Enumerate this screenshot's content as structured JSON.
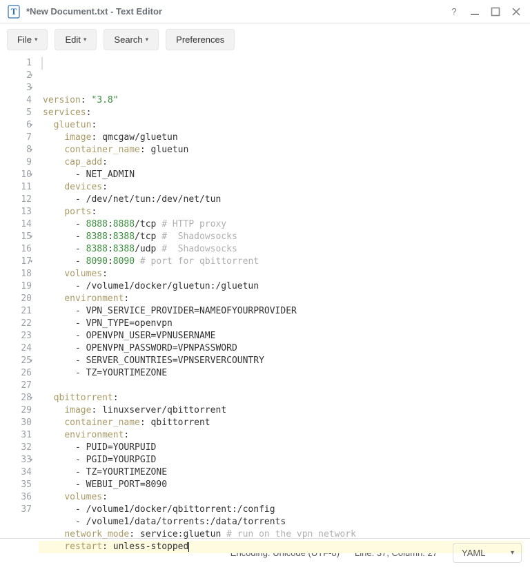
{
  "window": {
    "title": "*New Document.txt - Text Editor"
  },
  "menu": {
    "file": "File",
    "edit": "Edit",
    "search": "Search",
    "preferences": "Preferences"
  },
  "gutter": {
    "foldable": [
      2,
      3,
      6,
      8,
      10,
      15,
      17,
      25,
      28,
      33
    ]
  },
  "lines": {
    "1": {
      "i": "",
      "s": [
        [
          "key",
          "version"
        ],
        [
          "def",
          ": "
        ],
        [
          "str",
          "\"3.8\""
        ]
      ]
    },
    "2": {
      "i": "",
      "s": [
        [
          "key",
          "services"
        ],
        [
          "def",
          ":"
        ]
      ]
    },
    "3": {
      "i": "  ",
      "s": [
        [
          "key",
          "gluetun"
        ],
        [
          "def",
          ":"
        ]
      ]
    },
    "4": {
      "i": "    ",
      "s": [
        [
          "key",
          "image"
        ],
        [
          "def",
          ": qmcgaw/gluetun"
        ]
      ]
    },
    "5": {
      "i": "    ",
      "s": [
        [
          "key",
          "container_name"
        ],
        [
          "def",
          ": gluetun"
        ]
      ]
    },
    "6": {
      "i": "    ",
      "s": [
        [
          "key",
          "cap_add"
        ],
        [
          "def",
          ":"
        ]
      ]
    },
    "7": {
      "i": "      ",
      "s": [
        [
          "def",
          "- NET_ADMIN"
        ]
      ]
    },
    "8": {
      "i": "    ",
      "s": [
        [
          "key",
          "devices"
        ],
        [
          "def",
          ":"
        ]
      ]
    },
    "9": {
      "i": "      ",
      "s": [
        [
          "def",
          "- /dev/net/tun:/dev/net/tun"
        ]
      ]
    },
    "10": {
      "i": "    ",
      "s": [
        [
          "key",
          "ports"
        ],
        [
          "def",
          ":"
        ]
      ]
    },
    "11": {
      "i": "      ",
      "s": [
        [
          "def",
          "- "
        ],
        [
          "num",
          "8888"
        ],
        [
          "def",
          ":"
        ],
        [
          "num",
          "8888"
        ],
        [
          "def",
          "/tcp "
        ],
        [
          "cmt",
          "# HTTP proxy"
        ]
      ]
    },
    "12": {
      "i": "      ",
      "s": [
        [
          "def",
          "- "
        ],
        [
          "num",
          "8388"
        ],
        [
          "def",
          ":"
        ],
        [
          "num",
          "8388"
        ],
        [
          "def",
          "/tcp "
        ],
        [
          "cmt",
          "#  Shadowsocks"
        ]
      ]
    },
    "13": {
      "i": "      ",
      "s": [
        [
          "def",
          "- "
        ],
        [
          "num",
          "8388"
        ],
        [
          "def",
          ":"
        ],
        [
          "num",
          "8388"
        ],
        [
          "def",
          "/udp "
        ],
        [
          "cmt",
          "#  Shadowsocks"
        ]
      ]
    },
    "14": {
      "i": "      ",
      "s": [
        [
          "def",
          "- "
        ],
        [
          "num",
          "8090"
        ],
        [
          "def",
          ":"
        ],
        [
          "num",
          "8090"
        ],
        [
          "def",
          " "
        ],
        [
          "cmt",
          "# port for qbittorrent"
        ]
      ]
    },
    "15": {
      "i": "    ",
      "s": [
        [
          "key",
          "volumes"
        ],
        [
          "def",
          ":"
        ]
      ]
    },
    "16": {
      "i": "      ",
      "s": [
        [
          "def",
          "- /volume1/docker/gluetun:/gluetun"
        ]
      ]
    },
    "17": {
      "i": "    ",
      "s": [
        [
          "key",
          "environment"
        ],
        [
          "def",
          ":"
        ]
      ]
    },
    "18": {
      "i": "      ",
      "s": [
        [
          "def",
          "- VPN_SERVICE_PROVIDER=NAMEOFYOURPROVIDER"
        ]
      ]
    },
    "19": {
      "i": "      ",
      "s": [
        [
          "def",
          "- VPN_TYPE=openvpn"
        ]
      ]
    },
    "20": {
      "i": "      ",
      "s": [
        [
          "def",
          "- OPENVPN_USER=VPNUSERNAME"
        ]
      ]
    },
    "21": {
      "i": "      ",
      "s": [
        [
          "def",
          "- OPENVPN_PASSWORD=VPNPASSWORD"
        ]
      ]
    },
    "22": {
      "i": "      ",
      "s": [
        [
          "def",
          "- SERVER_COUNTRIES=VPNSERVERCOUNTRY"
        ]
      ]
    },
    "23": {
      "i": "      ",
      "s": [
        [
          "def",
          "- TZ=YOURTIMEZONE"
        ]
      ]
    },
    "24": {
      "i": "",
      "s": [
        [
          "def",
          ""
        ]
      ]
    },
    "25": {
      "i": "  ",
      "s": [
        [
          "key",
          "qbittorrent"
        ],
        [
          "def",
          ":"
        ]
      ]
    },
    "26": {
      "i": "    ",
      "s": [
        [
          "key",
          "image"
        ],
        [
          "def",
          ": linuxserver/qbittorrent"
        ]
      ]
    },
    "27": {
      "i": "    ",
      "s": [
        [
          "key",
          "container_name"
        ],
        [
          "def",
          ": qbittorrent"
        ]
      ]
    },
    "28": {
      "i": "    ",
      "s": [
        [
          "key",
          "environment"
        ],
        [
          "def",
          ":"
        ]
      ]
    },
    "29": {
      "i": "      ",
      "s": [
        [
          "def",
          "- PUID=YOURPUID"
        ]
      ]
    },
    "30": {
      "i": "      ",
      "s": [
        [
          "def",
          "- PGID=YOURPGID"
        ]
      ]
    },
    "31": {
      "i": "      ",
      "s": [
        [
          "def",
          "- TZ=YOURTIMEZONE"
        ]
      ]
    },
    "32": {
      "i": "      ",
      "s": [
        [
          "def",
          "- WEBUI_PORT=8090"
        ]
      ]
    },
    "33": {
      "i": "    ",
      "s": [
        [
          "key",
          "volumes"
        ],
        [
          "def",
          ":"
        ]
      ]
    },
    "34": {
      "i": "      ",
      "s": [
        [
          "def",
          "- /volume1/docker/qbittorrent:/config"
        ]
      ]
    },
    "35": {
      "i": "      ",
      "s": [
        [
          "def",
          "- /volume1/data/torrents:/data/torrents"
        ]
      ]
    },
    "36": {
      "i": "    ",
      "s": [
        [
          "key",
          "network_mode"
        ],
        [
          "def",
          ": service:gluetun "
        ],
        [
          "cmt",
          "# run on the vpn network"
        ]
      ]
    },
    "37": {
      "i": "    ",
      "s": [
        [
          "key",
          "restart"
        ],
        [
          "def",
          ": unless-stopped"
        ]
      ],
      "current": true,
      "caret": true
    }
  },
  "status": {
    "encoding_label": "Encoding:",
    "encoding_value": "Unicode (UTF-8)",
    "position": "Line: 37, Column: 27",
    "language": "YAML"
  }
}
